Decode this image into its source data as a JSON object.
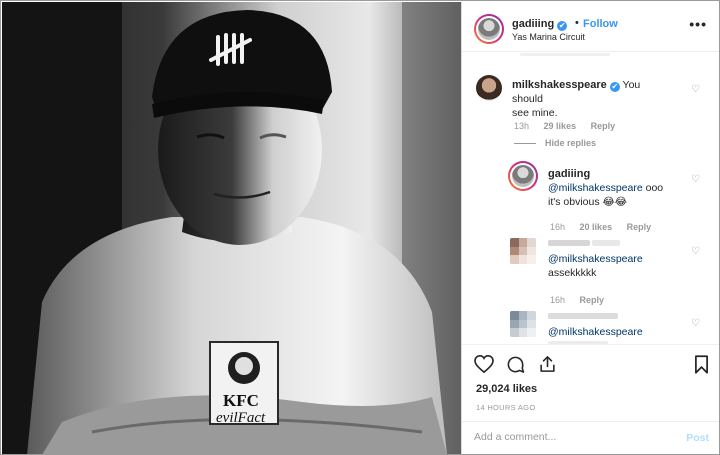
{
  "post": {
    "username": "gadiiing",
    "verified_glyph": "✔",
    "separator": "•",
    "follow_label": "Follow",
    "location": "Yas Marina Circuit",
    "more_label": "•••"
  },
  "photo": {
    "cap_logo": "UNDFTD",
    "shirt_brand": "KFC",
    "shirt_script": "evilFact"
  },
  "comments": [
    {
      "username": "milkshakesspeare",
      "text_line1": "You should",
      "text_line2": "see mine.",
      "time": "13h",
      "likes": "29 likes",
      "reply": "Reply",
      "hide_replies": "Hide replies"
    },
    {
      "username": "gadiiing",
      "mention": "@milkshakesspeare",
      "text_rest": "ooo",
      "text_line2": "it's obvious 😂😂",
      "time": "16h",
      "likes": "20 likes",
      "reply": "Reply"
    },
    {
      "mention": "@milkshakesspeare",
      "text_line2": "assekkkkk",
      "time": "16h",
      "reply": "Reply"
    },
    {
      "mention": "@milkshakesspeare"
    }
  ],
  "actions": {
    "likes": "29,024 likes",
    "timestamp": "14 HOURS AGO"
  },
  "composer": {
    "placeholder": "Add a comment...",
    "post_label": "Post"
  },
  "colors": {
    "accent": "#3897f0",
    "post_disabled": "#b2dffc",
    "muted": "#999999"
  }
}
